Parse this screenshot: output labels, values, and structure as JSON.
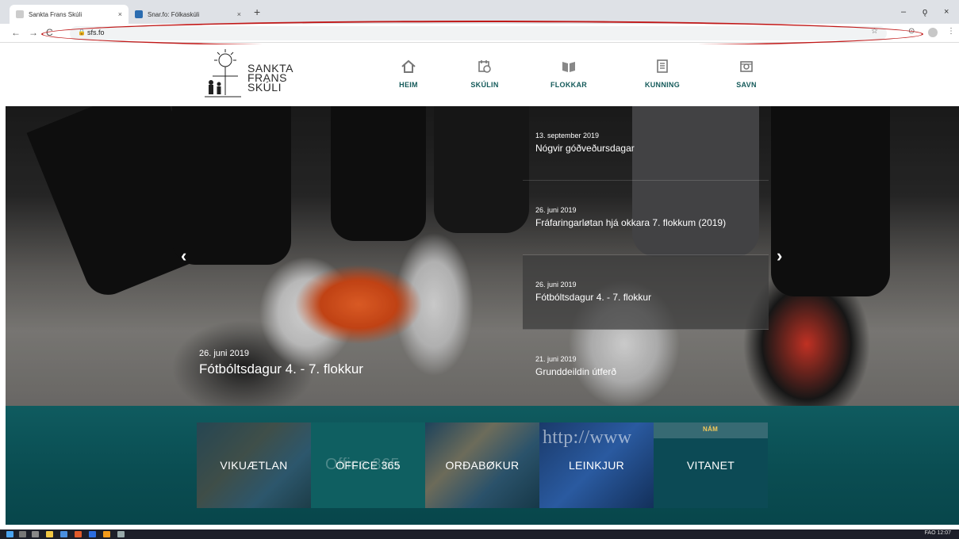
{
  "browser": {
    "tabs": [
      {
        "title": "Sankta Frans Skúli",
        "close": "×"
      },
      {
        "title": "Snar.fo: Fólkaskúli",
        "close": "×"
      }
    ],
    "new_tab": "+",
    "window_controls": {
      "minimize": "–",
      "restore": "ǫ",
      "close": "×"
    },
    "nav": {
      "back": "←",
      "forward": "→",
      "reload": "C"
    },
    "address": "sfs.fo",
    "lock": "🔒",
    "toolbar_icons": {
      "star": "☆",
      "ext": "⊙",
      "menu": "⋮"
    }
  },
  "site": {
    "logo_lines": [
      "SANKTA",
      "FRANS",
      "SKÚLI"
    ],
    "nav": [
      {
        "label": "HEIM",
        "icon": "home-icon"
      },
      {
        "label": "SKÚLIN",
        "icon": "calendar-clock-icon"
      },
      {
        "label": "FLOKKAR",
        "icon": "book-icon"
      },
      {
        "label": "KUNNING",
        "icon": "newspaper-icon"
      },
      {
        "label": "SAVN",
        "icon": "camera-icon"
      }
    ]
  },
  "hero": {
    "prev": "‹",
    "next": "›",
    "caption": {
      "date": "26. juni 2019",
      "title": "Fótbóltsdagur 4. - 7. flokkur"
    },
    "news": [
      {
        "date": "13. september 2019",
        "title": "Nógvir góðveðursdagar"
      },
      {
        "date": "26. juni 2019",
        "title": "Fráfaringarløtan hjá okkara 7. flokkum (2019)"
      },
      {
        "date": "26. juni 2019",
        "title": "Fótbóltsdagur 4. - 7. flokkur"
      },
      {
        "date": "21. juni 2019",
        "title": "Grunddeildin útferð"
      }
    ]
  },
  "tiles": [
    {
      "label": "VIKUÆTLAN"
    },
    {
      "label": "OFFICE 365",
      "sub": "Office 365"
    },
    {
      "label": "ORÐABØKUR"
    },
    {
      "label": "LEINKJUR",
      "sub": "http://www"
    },
    {
      "label": "VITANET",
      "sub1": "NÁM"
    }
  ],
  "taskbar": {
    "tray": "FAO  12:07"
  },
  "colors": {
    "accent": "#145a5a",
    "band": "#0a4d52",
    "highlight": "#c01818"
  }
}
